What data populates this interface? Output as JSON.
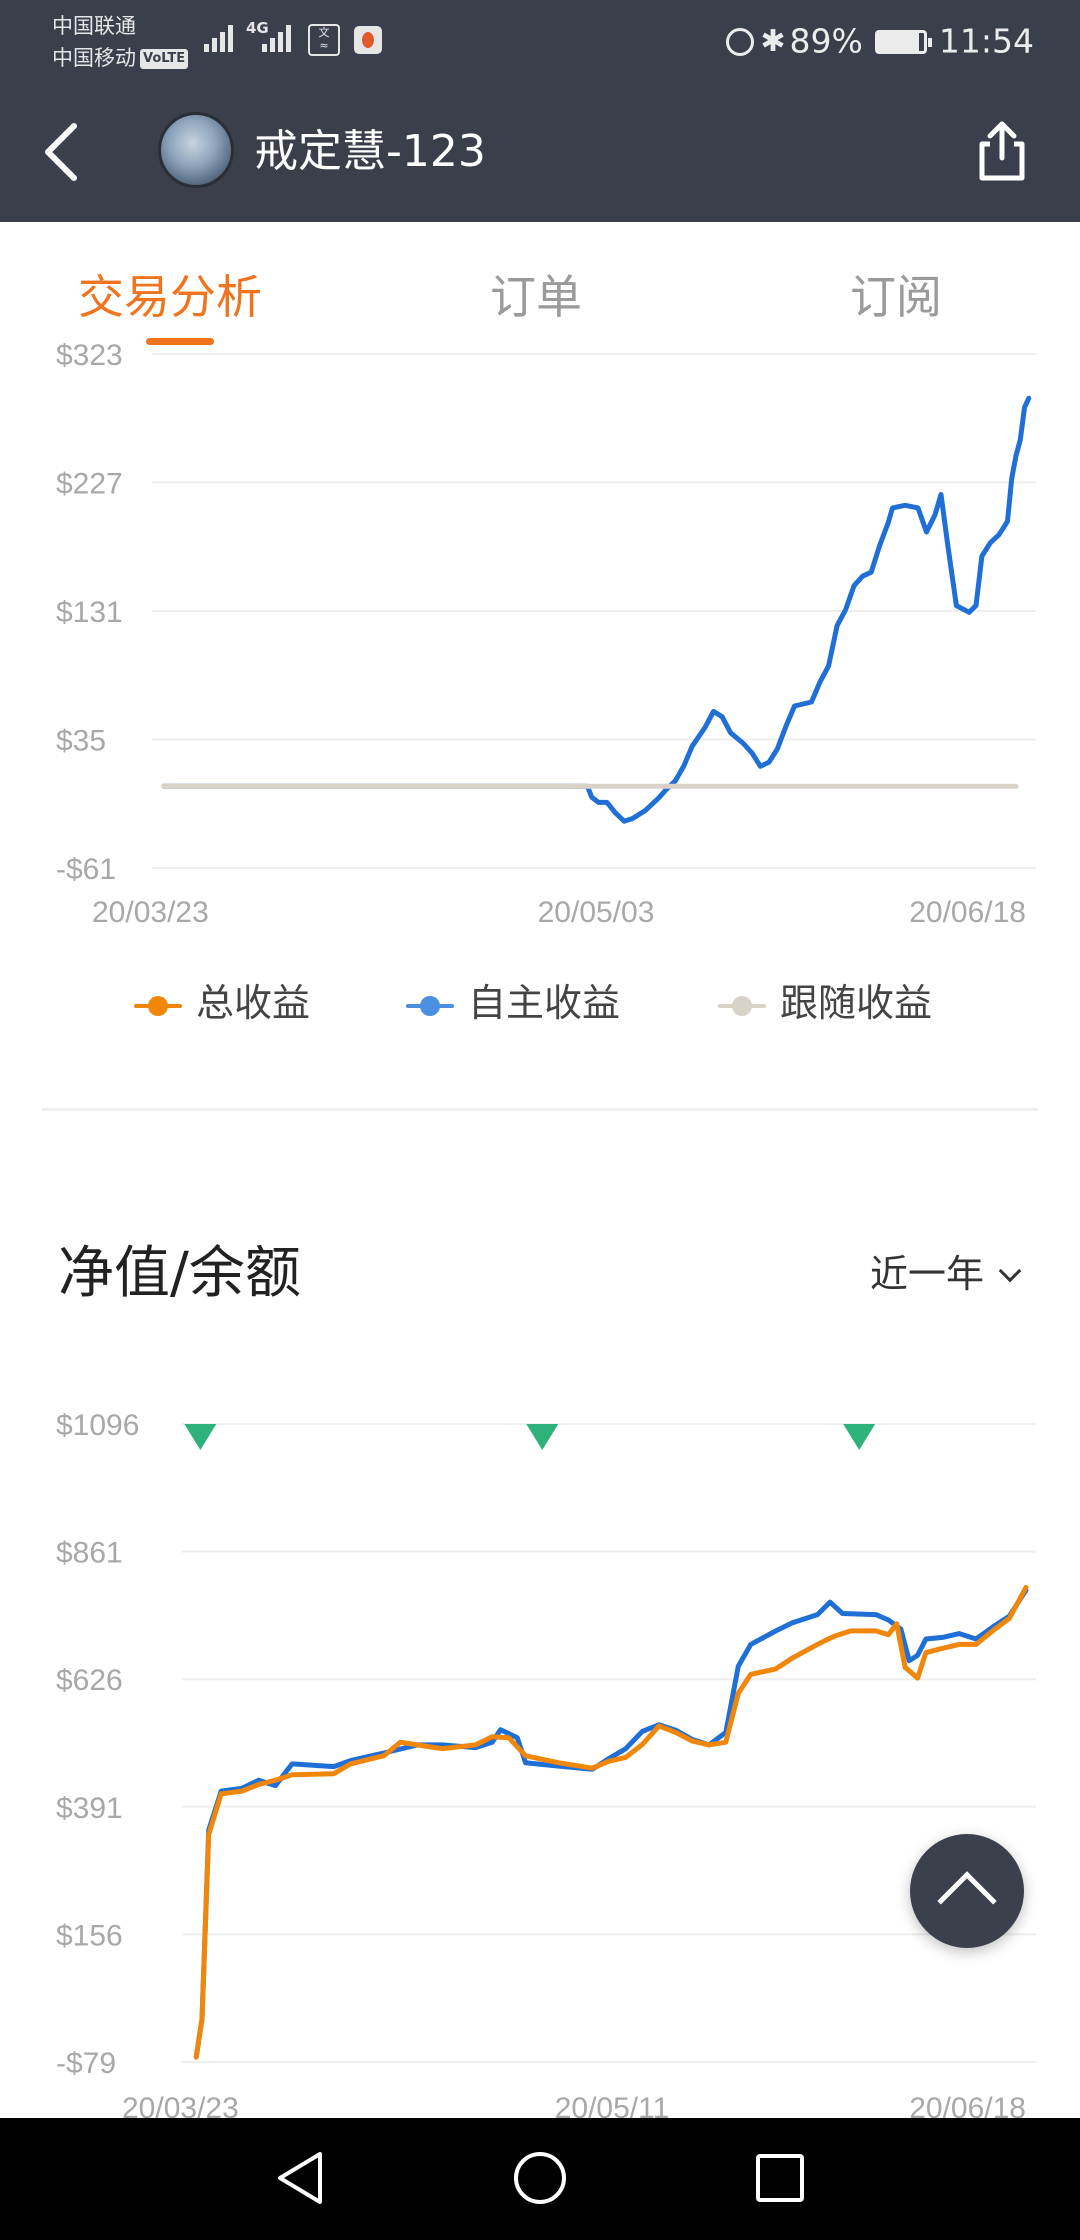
{
  "status_bar": {
    "carrier_1": "中国联通",
    "carrier_2": "中国移动",
    "volte": "VoLTE",
    "net": "4G",
    "battery": "89%",
    "time": "11:54",
    "icons": [
      "signal-icon",
      "alarm-icon",
      "bluetooth-icon",
      "battery-icon"
    ]
  },
  "header": {
    "title": "戒定慧-123",
    "icons": [
      "back-arrow-icon",
      "avatar",
      "share-icon"
    ]
  },
  "tabs": [
    {
      "label": "交易分析",
      "active": true
    },
    {
      "label": "订单",
      "active": false
    },
    {
      "label": "订阅",
      "active": false
    }
  ],
  "accent_color": "#f0741e",
  "profit_chart": {
    "legend": [
      {
        "label": "总收益",
        "color": "#f0860a"
      },
      {
        "label": "自主收益",
        "color": "#4a8fe0"
      },
      {
        "label": "跟随收益",
        "color": "#d8d2c8"
      }
    ]
  },
  "net_value": {
    "title": "净值/余额",
    "period": "近一年",
    "marker_color": "#2db37a"
  },
  "scroll_top_icon": "chevron-up-icon",
  "nav_icons": [
    "back-triangle-icon",
    "home-circle-icon",
    "recents-square-icon"
  ],
  "chart_data": [
    {
      "type": "line",
      "y_ticks": [
        "$323",
        "$227",
        "$131",
        "$35",
        "-$61"
      ],
      "x_ticks": [
        "20/03/23",
        "20/05/03",
        "20/06/18"
      ],
      "ylim": [
        -61,
        323
      ],
      "series": [
        {
          "name": "自主收益",
          "color": "#1f6fd6",
          "points": [
            [
              0,
              0
            ],
            [
              0.497,
              0
            ],
            [
              0.502,
              -8
            ],
            [
              0.51,
              -12
            ],
            [
              0.52,
              -12
            ],
            [
              0.53,
              -20
            ],
            [
              0.54,
              -26
            ],
            [
              0.55,
              -24
            ],
            [
              0.565,
              -18
            ],
            [
              0.58,
              -9
            ],
            [
              0.59,
              -2
            ],
            [
              0.6,
              4
            ],
            [
              0.61,
              15
            ],
            [
              0.62,
              30
            ],
            [
              0.635,
              44
            ],
            [
              0.645,
              56
            ],
            [
              0.655,
              52
            ],
            [
              0.665,
              40
            ],
            [
              0.68,
              32
            ],
            [
              0.69,
              25
            ],
            [
              0.7,
              15
            ],
            [
              0.71,
              18
            ],
            [
              0.72,
              28
            ],
            [
              0.73,
              45
            ],
            [
              0.74,
              60
            ],
            [
              0.76,
              63
            ],
            [
              0.77,
              78
            ],
            [
              0.78,
              90
            ],
            [
              0.79,
              120
            ],
            [
              0.8,
              132
            ],
            [
              0.81,
              150
            ],
            [
              0.82,
              157
            ],
            [
              0.83,
              160
            ],
            [
              0.84,
              180
            ],
            [
              0.85,
              197
            ],
            [
              0.855,
              208
            ],
            [
              0.87,
              210
            ],
            [
              0.885,
              208
            ],
            [
              0.895,
              190
            ],
            [
              0.905,
              203
            ],
            [
              0.912,
              218
            ],
            [
              0.92,
              180
            ],
            [
              0.93,
              135
            ],
            [
              0.945,
              130
            ],
            [
              0.953,
              135
            ],
            [
              0.96,
              172
            ],
            [
              0.97,
              182
            ],
            [
              0.98,
              188
            ],
            [
              0.99,
              198
            ],
            [
              0.995,
              230
            ],
            [
              1.0,
              247
            ],
            [
              1.005,
              259
            ],
            [
              1.01,
              283
            ],
            [
              1.015,
              290
            ]
          ]
        },
        {
          "name": "跟随收益",
          "color": "#d8d2c8",
          "points": [
            [
              0,
              0
            ],
            [
              1.0,
              0
            ]
          ]
        }
      ]
    },
    {
      "type": "line",
      "y_ticks": [
        "$1096",
        "$861",
        "$626",
        "$391",
        "$156",
        "-$79"
      ],
      "x_ticks": [
        "20/03/23",
        "20/05/11",
        "20/06/18"
      ],
      "ylim": [
        -79,
        1096
      ],
      "markers": [
        0.01,
        0.42,
        0.8
      ],
      "series": [
        {
          "name": "自主收益",
          "color": "#1f6fd6",
          "points": [
            [
              0.005,
              -70
            ],
            [
              0.012,
              0
            ],
            [
              0.02,
              348
            ],
            [
              0.035,
              420
            ],
            [
              0.06,
              425
            ],
            [
              0.08,
              440
            ],
            [
              0.1,
              430
            ],
            [
              0.12,
              470
            ],
            [
              0.17,
              465
            ],
            [
              0.19,
              476
            ],
            [
              0.23,
              490
            ],
            [
              0.27,
              505
            ],
            [
              0.3,
              505
            ],
            [
              0.34,
              500
            ],
            [
              0.36,
              510
            ],
            [
              0.37,
              533
            ],
            [
              0.39,
              518
            ],
            [
              0.4,
              472
            ],
            [
              0.44,
              466
            ],
            [
              0.48,
              460
            ],
            [
              0.5,
              480
            ],
            [
              0.52,
              498
            ],
            [
              0.54,
              530
            ],
            [
              0.56,
              542
            ],
            [
              0.58,
              532
            ],
            [
              0.6,
              515
            ],
            [
              0.62,
              505
            ],
            [
              0.64,
              528
            ],
            [
              0.655,
              650
            ],
            [
              0.67,
              690
            ],
            [
              0.7,
              715
            ],
            [
              0.72,
              730
            ],
            [
              0.75,
              745
            ],
            [
              0.765,
              768
            ],
            [
              0.78,
              747
            ],
            [
              0.82,
              745
            ],
            [
              0.835,
              735
            ],
            [
              0.85,
              718
            ],
            [
              0.86,
              660
            ],
            [
              0.87,
              670
            ],
            [
              0.88,
              700
            ],
            [
              0.9,
              703
            ],
            [
              0.92,
              710
            ],
            [
              0.94,
              700
            ],
            [
              0.96,
              722
            ],
            [
              0.98,
              742
            ],
            [
              1.0,
              790
            ]
          ]
        },
        {
          "name": "总收益",
          "color": "#f0860a",
          "points": [
            [
              0.005,
              -70
            ],
            [
              0.012,
              0
            ],
            [
              0.02,
              340
            ],
            [
              0.035,
              415
            ],
            [
              0.06,
              420
            ],
            [
              0.08,
              432
            ],
            [
              0.1,
              440
            ],
            [
              0.12,
              450
            ],
            [
              0.17,
              452
            ],
            [
              0.19,
              470
            ],
            [
              0.23,
              485
            ],
            [
              0.25,
              510
            ],
            [
              0.27,
              505
            ],
            [
              0.3,
              498
            ],
            [
              0.34,
              505
            ],
            [
              0.36,
              520
            ],
            [
              0.38,
              518
            ],
            [
              0.4,
              485
            ],
            [
              0.44,
              472
            ],
            [
              0.48,
              462
            ],
            [
              0.5,
              475
            ],
            [
              0.52,
              482
            ],
            [
              0.54,
              506
            ],
            [
              0.56,
              540
            ],
            [
              0.58,
              528
            ],
            [
              0.6,
              512
            ],
            [
              0.62,
              505
            ],
            [
              0.64,
              510
            ],
            [
              0.655,
              600
            ],
            [
              0.67,
              635
            ],
            [
              0.7,
              645
            ],
            [
              0.72,
              665
            ],
            [
              0.75,
              690
            ],
            [
              0.77,
              705
            ],
            [
              0.79,
              715
            ],
            [
              0.82,
              715
            ],
            [
              0.835,
              708
            ],
            [
              0.845,
              728
            ],
            [
              0.855,
              648
            ],
            [
              0.87,
              628
            ],
            [
              0.88,
              675
            ],
            [
              0.9,
              683
            ],
            [
              0.92,
              690
            ],
            [
              0.94,
              690
            ],
            [
              0.96,
              715
            ],
            [
              0.98,
              738
            ],
            [
              1.0,
              795
            ]
          ]
        }
      ]
    }
  ]
}
